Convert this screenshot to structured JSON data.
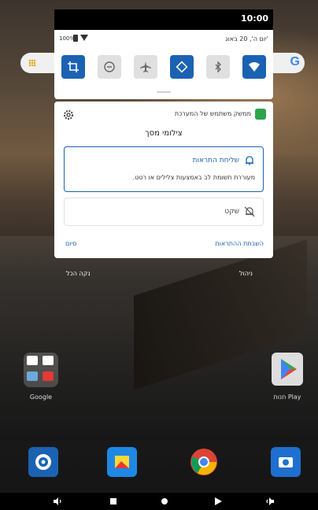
{
  "status_bar": {
    "time": "10:00"
  },
  "quick_settings": {
    "battery": "100%",
    "date": "יום ה', 20 באוג'",
    "tiles": [
      {
        "icon": "crop-icon",
        "state": "on"
      },
      {
        "icon": "dnd-icon",
        "state": "off"
      },
      {
        "icon": "airplane-icon",
        "state": "off"
      },
      {
        "icon": "auto-rotate-icon",
        "state": "on"
      },
      {
        "icon": "bluetooth-icon",
        "state": "off"
      },
      {
        "icon": "wifi-icon",
        "state": "on"
      }
    ]
  },
  "notification": {
    "app_name": "ממשק משתמש של המערכת",
    "title": "צילומי מסך",
    "alert_option": {
      "label": "שליחת התראות",
      "description": "מעוררת תשומת לב באמצעות צלילים או רטט."
    },
    "silent_option": {
      "label": "שקט"
    },
    "turn_off_label": "השבתת ההתראות",
    "done_label": "סיום"
  },
  "shade_actions": {
    "manage": "ניהול",
    "clear_all": "נקה הכל"
  },
  "home": {
    "folder_label": "Google",
    "play_label": "חנות Play"
  },
  "colors": {
    "accent": "#1b62b3",
    "card_bg": "#ffffff"
  }
}
